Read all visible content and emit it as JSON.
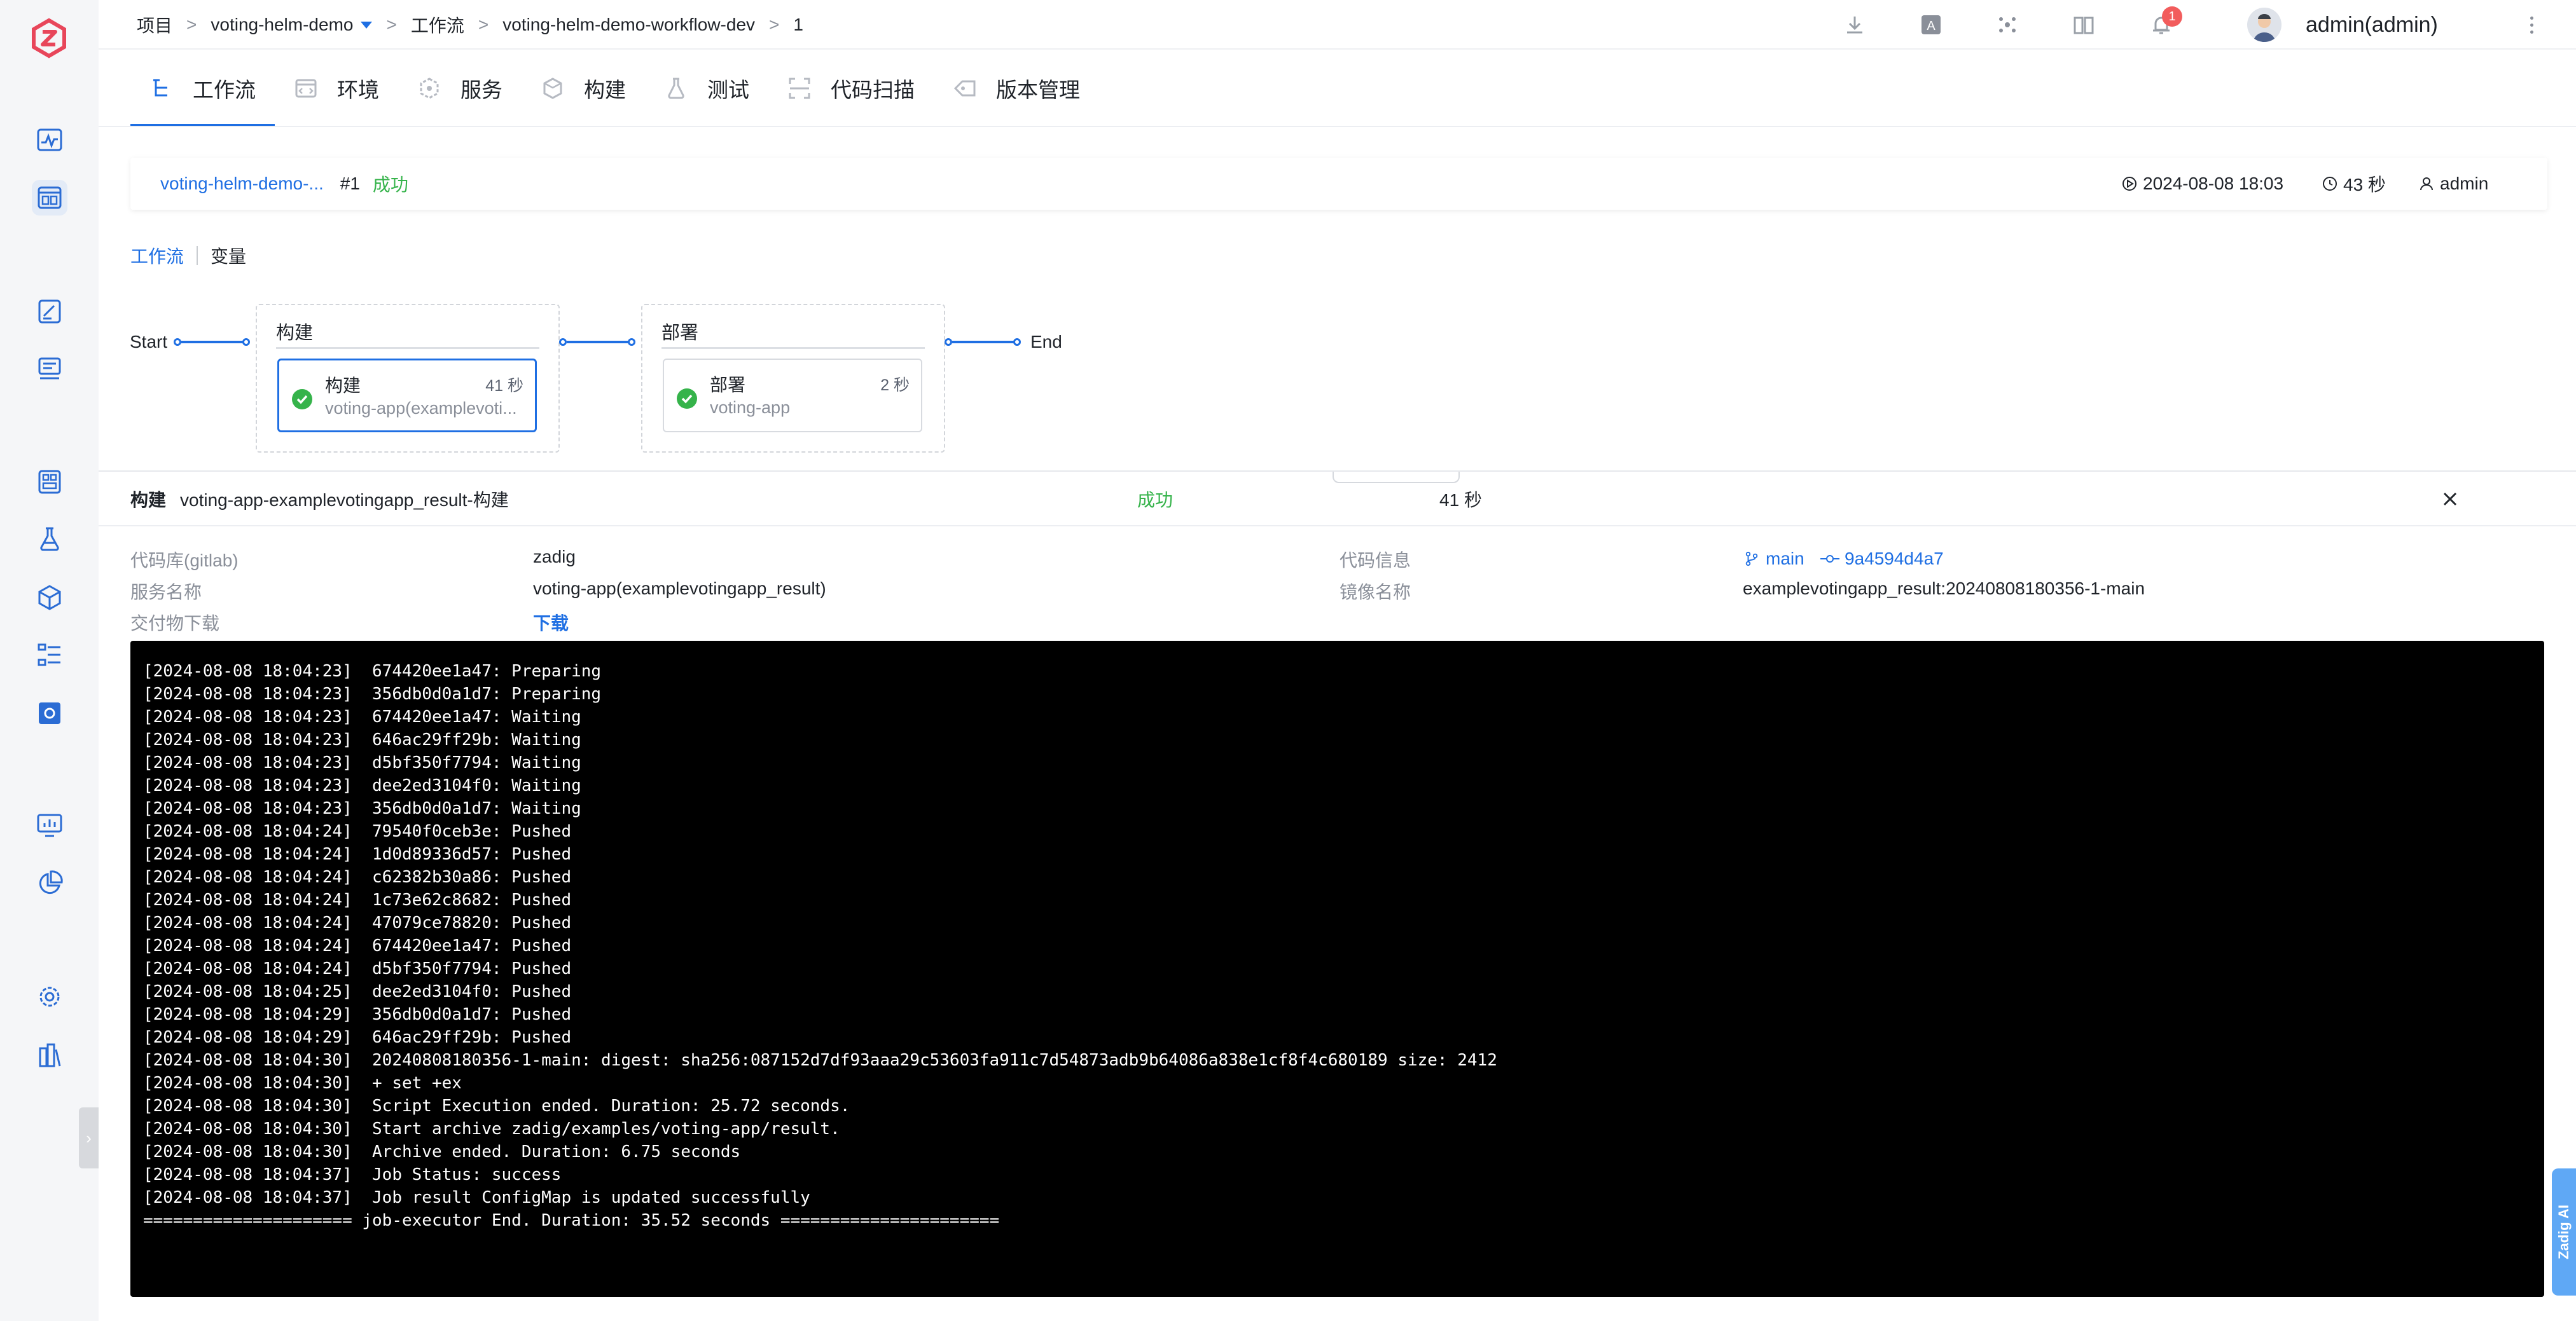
{
  "breadcrumb": {
    "root": "项目",
    "project": "voting-helm-demo",
    "section": "工作流",
    "workflow": "voting-helm-demo-workflow-dev",
    "run": "1"
  },
  "topbar": {
    "notification_count": "1",
    "user": "admin(admin)"
  },
  "tabs": [
    {
      "label": "工作流",
      "icon": "workflow-icon"
    },
    {
      "label": "环境",
      "icon": "environment-icon"
    },
    {
      "label": "服务",
      "icon": "service-icon"
    },
    {
      "label": "构建",
      "icon": "build-icon"
    },
    {
      "label": "测试",
      "icon": "test-icon"
    },
    {
      "label": "代码扫描",
      "icon": "code-scan-icon"
    },
    {
      "label": "版本管理",
      "icon": "version-icon"
    }
  ],
  "run": {
    "name": "voting-helm-demo-...",
    "number": "#1",
    "status": "成功",
    "time": "2024-08-08 18:03",
    "duration": "43 秒",
    "user": "admin"
  },
  "view_switch": {
    "active": "工作流",
    "other": "变量"
  },
  "flow": {
    "start": "Start",
    "end": "End",
    "stages": [
      {
        "title": "构建",
        "job": {
          "name": "构建",
          "duration": "41 秒",
          "sub": "voting-app(examplevoti..."
        }
      },
      {
        "title": "部署",
        "job": {
          "name": "部署",
          "duration": "2 秒",
          "sub": "voting-app"
        }
      }
    ]
  },
  "detail": {
    "type": "构建",
    "title": "voting-app-examplevotingapp_result-构建",
    "status": "成功",
    "duration": "41 秒",
    "repo_label": "代码库(gitlab)",
    "repo_value": "zadig",
    "code_info_label": "代码信息",
    "branch": "main",
    "commit": "9a4594d4a7",
    "service_label": "服务名称",
    "service_value": "voting-app(examplevotingapp_result)",
    "image_label": "镜像名称",
    "image_value": "examplevotingapp_result:20240808180356-1-main",
    "artifact_label": "交付物下载",
    "artifact_link": "下载"
  },
  "logs": [
    "[2024-08-08 18:04:23]  674420ee1a47: Preparing",
    "[2024-08-08 18:04:23]  356db0d0a1d7: Preparing",
    "[2024-08-08 18:04:23]  674420ee1a47: Waiting",
    "[2024-08-08 18:04:23]  646ac29ff29b: Waiting",
    "[2024-08-08 18:04:23]  d5bf350f7794: Waiting",
    "[2024-08-08 18:04:23]  dee2ed3104f0: Waiting",
    "[2024-08-08 18:04:23]  356db0d0a1d7: Waiting",
    "[2024-08-08 18:04:24]  79540f0ceb3e: Pushed",
    "[2024-08-08 18:04:24]  1d0d89336d57: Pushed",
    "[2024-08-08 18:04:24]  c62382b30a86: Pushed",
    "[2024-08-08 18:04:24]  1c73e62c8682: Pushed",
    "[2024-08-08 18:04:24]  47079ce78820: Pushed",
    "[2024-08-08 18:04:24]  674420ee1a47: Pushed",
    "[2024-08-08 18:04:24]  d5bf350f7794: Pushed",
    "[2024-08-08 18:04:25]  dee2ed3104f0: Pushed",
    "[2024-08-08 18:04:29]  356db0d0a1d7: Pushed",
    "[2024-08-08 18:04:29]  646ac29ff29b: Pushed",
    "[2024-08-08 18:04:30]  20240808180356-1-main: digest: sha256:087152d7df93aaa29c53603fa911c7d54873adb9b64086a838e1cf8f4c680189 size: 2412",
    "[2024-08-08 18:04:30]  + set +ex",
    "[2024-08-08 18:04:30]  Script Execution ended. Duration: 25.72 seconds.",
    "[2024-08-08 18:04:30]  Start archive zadig/examples/voting-app/result.",
    "[2024-08-08 18:04:30]  Archive ended. Duration: 6.75 seconds",
    "[2024-08-08 18:04:37]  Job Status: success",
    "[2024-08-08 18:04:37]  Job result ConfigMap is updated successfully",
    "===================== job-executor End. Duration: 35.52 seconds ======================"
  ],
  "ai_tab": "Zadig AI",
  "colors": {
    "accent": "#1f6fe3",
    "success": "#35b34a",
    "badge": "#f25c5c"
  }
}
